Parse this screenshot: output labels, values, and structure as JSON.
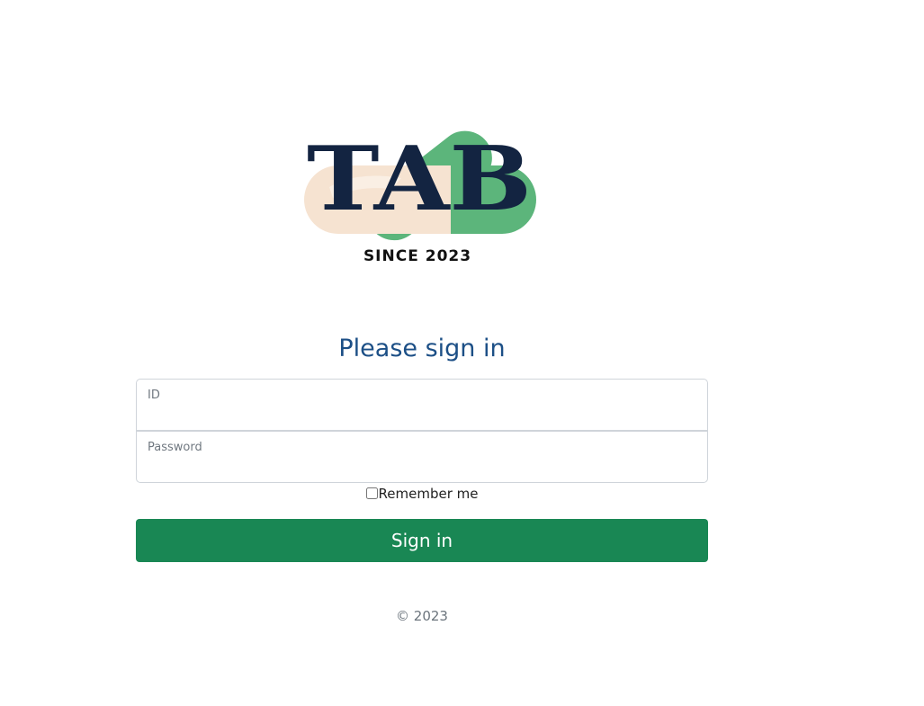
{
  "logo": {
    "wordmark": "TAB",
    "since": "SINCE 2023",
    "colors": {
      "green": "#5cb57b",
      "cream": "#f6e3d1",
      "navy": "#132441"
    }
  },
  "form": {
    "title": "Please sign in",
    "id_label": "ID",
    "id_value": "",
    "password_label": "Password",
    "password_value": "",
    "remember_label": "Remember me",
    "remember_checked": false,
    "submit_label": "Sign in"
  },
  "footer": {
    "copyright": "© 2023"
  },
  "colors": {
    "title": "#1c4f86",
    "button": "#198754",
    "border": "#cfd4da"
  }
}
